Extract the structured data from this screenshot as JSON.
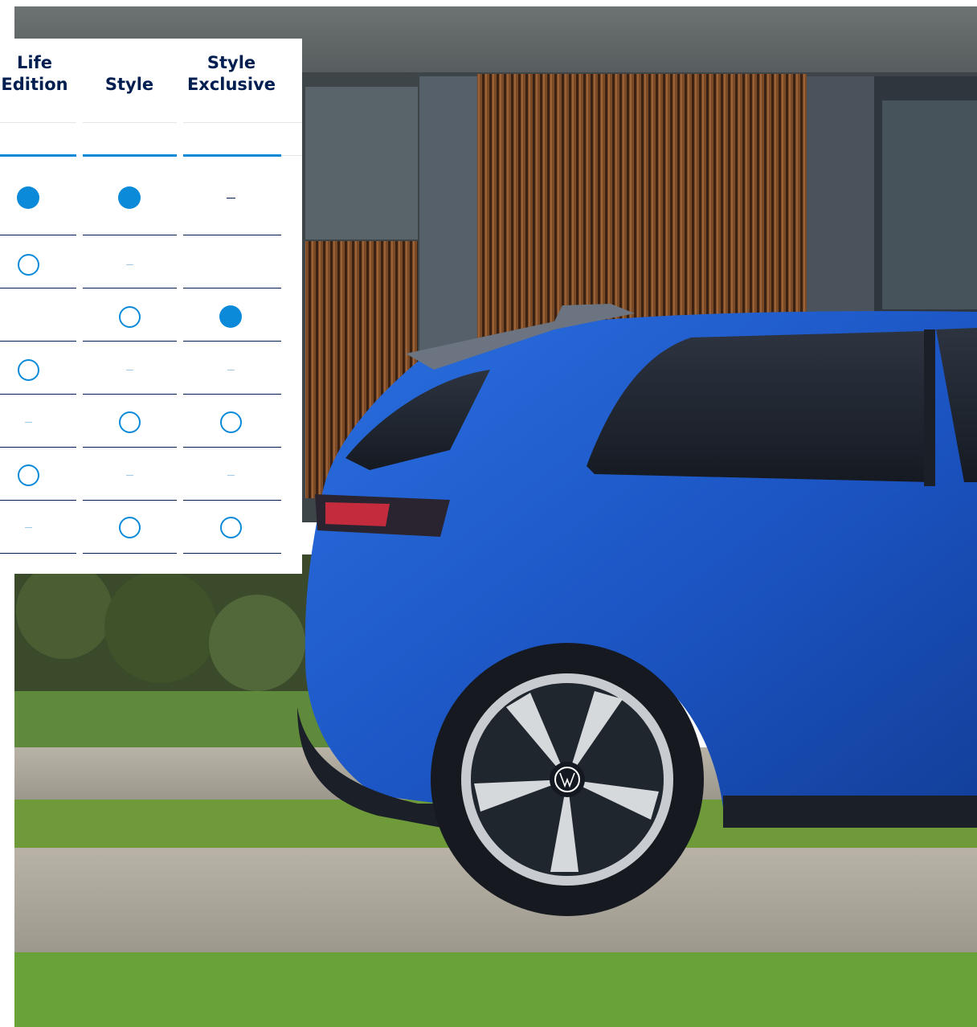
{
  "columns": [
    {
      "key": "life_edition",
      "line1": "Life",
      "line2": "Edition"
    },
    {
      "key": "style",
      "line1": "",
      "line2": "Style"
    },
    {
      "key": "style_exclusive",
      "line1": "Style",
      "line2": "Exclusive"
    }
  ],
  "rows": [
    [
      "filled",
      "filled",
      "dash-dark"
    ],
    [
      "outline",
      "dash",
      ""
    ],
    [
      "",
      "outline",
      "filled"
    ],
    [
      "outline",
      "dash",
      "dash"
    ],
    [
      "dash",
      "outline",
      "outline"
    ],
    [
      "outline",
      "dash",
      "dash"
    ],
    [
      "dash",
      "outline",
      "outline"
    ]
  ],
  "colors": {
    "accent": "#0b8ada",
    "text": "#001e50",
    "car": "#1f5fd0"
  },
  "photo": {
    "subject": "blue-hatchback-side-rear",
    "badge": "vw-logo-icon"
  }
}
